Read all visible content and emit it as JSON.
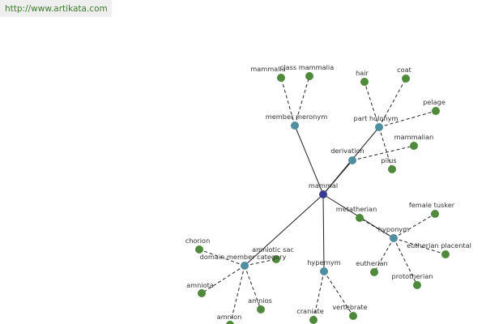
{
  "header": {
    "url": "http://www.artikata.com"
  },
  "colors": {
    "center": "#3b3b91",
    "relation": "#4e8ea0",
    "leaf": "#4f8a3c",
    "edge": "#222222"
  },
  "graph": {
    "center": "mammal",
    "relations": [
      {
        "id": "member_meronym",
        "label": "member meronym",
        "leaves": [
          "mammalia",
          "class mammalia"
        ]
      },
      {
        "id": "part_holonym",
        "label": "part holonym",
        "leaves": [
          "hair",
          "coat",
          "pelage",
          "pilus"
        ]
      },
      {
        "id": "derivation",
        "label": "derivation",
        "leaves": [
          "mammalian"
        ]
      },
      {
        "id": "hyponym",
        "label": "hyponym",
        "leaves": [
          "female tusker",
          "eutherian placental",
          "prototherian",
          "eutherian",
          "metatherian"
        ]
      },
      {
        "id": "hypernym",
        "label": "hypernym",
        "leaves": [
          "craniate",
          "vertebrate"
        ]
      },
      {
        "id": "domain_member_category",
        "label": "domain member category",
        "leaves": [
          "chorion",
          "amniotic sac",
          "amnios",
          "amnion",
          "amniota"
        ]
      }
    ]
  }
}
